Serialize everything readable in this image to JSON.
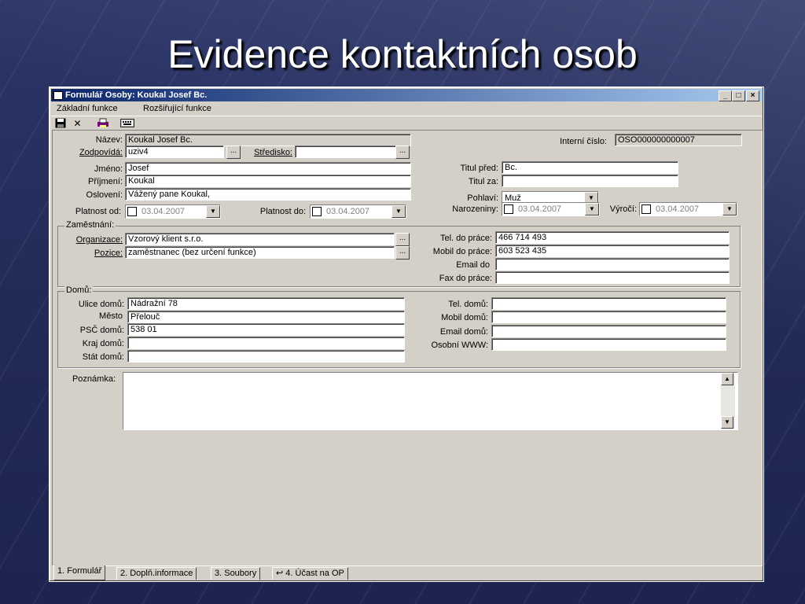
{
  "slide": {
    "title": "Evidence kontaktních osob"
  },
  "window": {
    "title": "Formulář Osoby: Koukal Josef Bc.",
    "min": "_",
    "max": "□",
    "close": "×"
  },
  "menu": [
    "Základní funkce",
    "Rozšiřující funkce"
  ],
  "toolbar": {
    "icons": [
      "save-icon",
      "delete-icon",
      "print-icon",
      "keyboard-icon"
    ],
    "delete_glyph": "✕"
  },
  "fields": {
    "nazev": {
      "label": "Název:",
      "value": "Koukal Josef Bc."
    },
    "zodpovida": {
      "label": "Zodpovídá:",
      "value": "uziv4"
    },
    "stredisko": {
      "label": "Středisko:",
      "value": ""
    },
    "interni": {
      "label": "Interní číslo:",
      "value": "OSO000000000007"
    },
    "jmeno": {
      "label": "Jméno:",
      "value": "Josef"
    },
    "prijmeni": {
      "label": "Příjmení:",
      "value": "Koukal"
    },
    "osloveni": {
      "label": "Oslovení:",
      "value": "Vážený pane Koukal,"
    },
    "titul_pred": {
      "label": "Titul před:",
      "value": "Bc."
    },
    "titul_za": {
      "label": "Titul za:",
      "value": ""
    },
    "pohlavi": {
      "label": "Pohlaví:",
      "value": "Muž"
    },
    "platnost_od": {
      "label": "Platnost od:",
      "value": "03.04.2007"
    },
    "platnost_do": {
      "label": "Platnost do:",
      "value": "03.04.2007"
    },
    "narozeniny": {
      "label": "Narozeniny:",
      "value": "03.04.2007"
    },
    "vyroci": {
      "label": "Výročí:",
      "value": "03.04.2007"
    }
  },
  "zamestnani": {
    "title": "Zaměstnání:",
    "organizace": {
      "label": "Organizace:",
      "value": "Vzorový klient s.r.o."
    },
    "pozice": {
      "label": "Pozice:",
      "value": "zaměstnanec (bez určení funkce)"
    },
    "tel_prace": {
      "label": "Tel. do práce:",
      "value": "466 714 493"
    },
    "mobil_prace": {
      "label": "Mobil do práce:",
      "value": "603 523 435"
    },
    "email_do": {
      "label": "Email do",
      "value": ""
    },
    "fax_prace": {
      "label": "Fax do práce:",
      "value": ""
    }
  },
  "domu": {
    "title": "Domů:",
    "ulice": {
      "label": "Ulice domů:",
      "value": "Nádražní 78"
    },
    "mesto": {
      "label": "Město",
      "value": "Přelouč"
    },
    "psc": {
      "label": "PSČ domů:",
      "value": "538 01"
    },
    "kraj": {
      "label": "Kraj domů:",
      "value": ""
    },
    "stat": {
      "label": "Stát domů:",
      "value": ""
    },
    "tel": {
      "label": "Tel. domů:",
      "value": ""
    },
    "mobil": {
      "label": "Mobil domů:",
      "value": ""
    },
    "email": {
      "label": "Email domů:",
      "value": ""
    },
    "www": {
      "label": "Osobní WWW:",
      "value": ""
    }
  },
  "poznamka": {
    "label": "Poznámka:",
    "value": ""
  },
  "tabs": [
    "1. Formulář",
    "2. Doplň.informace",
    "3. Soubory",
    "↩ 4. Účast na OP"
  ],
  "glyphs": {
    "ellipsis": "...",
    "dropdown": "▼",
    "up": "▲",
    "down": "▼"
  }
}
